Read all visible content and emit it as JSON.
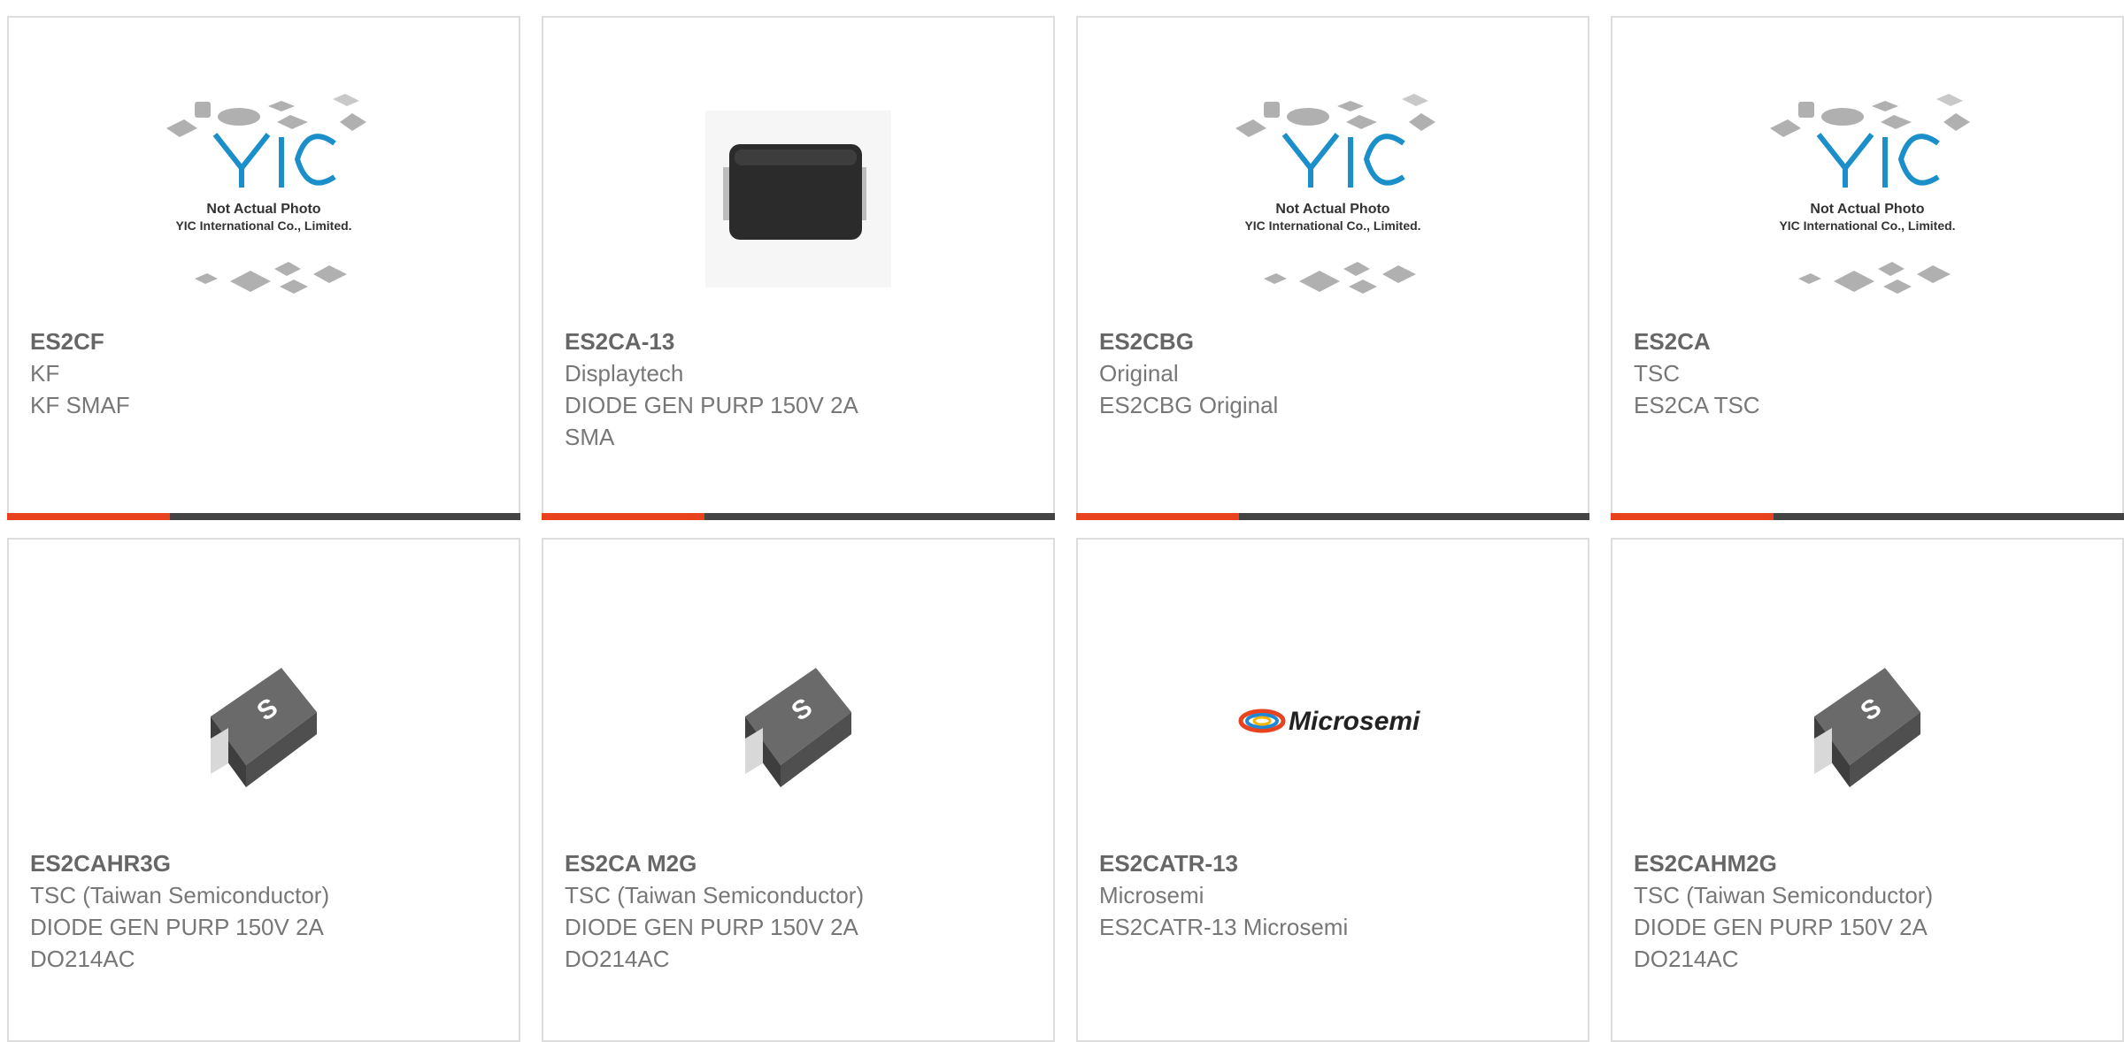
{
  "products": [
    {
      "part": "ES2CF",
      "brand": "KF",
      "desc": "KF SMAF",
      "image": "yic-placeholder-icon"
    },
    {
      "part": "ES2CA-13",
      "brand": "Displaytech",
      "desc": "DIODE GEN PURP 150V 2A SMA",
      "image": "sma-diode-icon"
    },
    {
      "part": "ES2CBG",
      "brand": "Original",
      "desc": "ES2CBG Original",
      "image": "yic-placeholder-icon"
    },
    {
      "part": "ES2CA",
      "brand": "TSC",
      "desc": "ES2CA TSC",
      "image": "yic-placeholder-icon"
    },
    {
      "part": "ES2CAHR3G",
      "brand": "TSC (Taiwan Semiconductor)",
      "desc1": "DIODE GEN PURP 150V 2A",
      "desc2": "DO214AC",
      "image": "tsc-diode-icon"
    },
    {
      "part": "ES2CA M2G",
      "brand": "TSC (Taiwan Semiconductor)",
      "desc1": "DIODE GEN PURP 150V 2A",
      "desc2": "DO214AC",
      "image": "tsc-diode-icon"
    },
    {
      "part": "ES2CATR-13",
      "brand": "Microsemi",
      "desc": "ES2CATR-13 Microsemi",
      "image": "microsemi-logo"
    },
    {
      "part": "ES2CAHM2G",
      "brand": "TSC (Taiwan Semiconductor)",
      "desc1": "DIODE GEN PURP 150V 2A",
      "desc2": "DO214AC",
      "image": "tsc-diode-icon"
    }
  ],
  "placeholder": {
    "brand": "YIC",
    "line1": "Not Actual Photo",
    "line2": "YIC International Co., Limited."
  },
  "microsemi": {
    "name": "Microsemi"
  },
  "colors": {
    "accent": "#e8421e",
    "bar": "#444444",
    "border": "#dddddd"
  }
}
